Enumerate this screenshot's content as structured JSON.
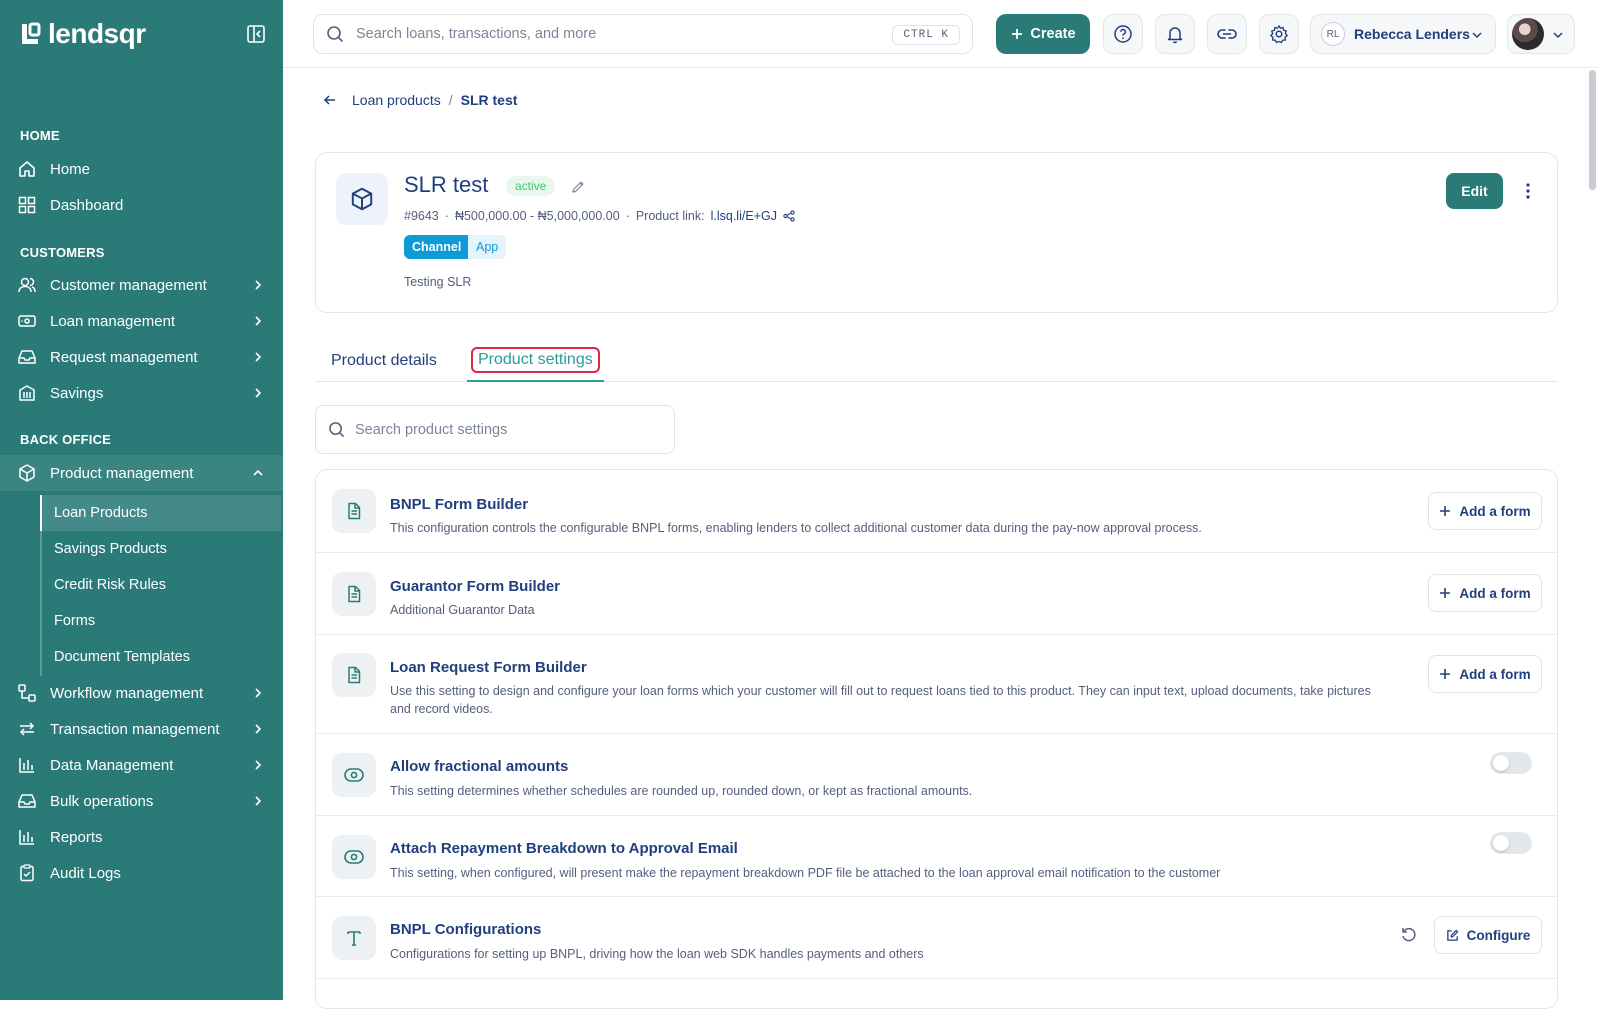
{
  "brand": {
    "name": "lendsqr"
  },
  "colors": {
    "sidebar": "#2a7a78",
    "primary": "#2a7a78",
    "accent_tab": "#2a9d98",
    "active_badge": "#39cd62",
    "channel_pill": "#0d9ad6",
    "highlight_outline": "#d9264a"
  },
  "sidebar": {
    "sections": [
      {
        "title": "HOME",
        "items": [
          {
            "label": "Home",
            "icon": "home-icon"
          },
          {
            "label": "Dashboard",
            "icon": "dashboard-icon"
          }
        ]
      },
      {
        "title": "CUSTOMERS",
        "items": [
          {
            "label": "Customer management",
            "icon": "users-icon"
          },
          {
            "label": "Loan management",
            "icon": "money-icon"
          },
          {
            "label": "Request management",
            "icon": "inbox-icon"
          },
          {
            "label": "Savings",
            "icon": "bank-icon"
          }
        ]
      },
      {
        "title": "BACK OFFICE",
        "items": [
          {
            "label": "Product management",
            "icon": "box-icon",
            "expanded": true,
            "children": [
              "Loan Products",
              "Savings Products",
              "Credit Risk Rules",
              "Forms",
              "Document Templates"
            ],
            "active_child": "Loan Products"
          },
          {
            "label": "Workflow management",
            "icon": "workflow-icon"
          },
          {
            "label": "Transaction management",
            "icon": "transfer-icon"
          },
          {
            "label": "Data Management",
            "icon": "bar-chart-icon"
          },
          {
            "label": "Bulk operations",
            "icon": "inbox-icon"
          },
          {
            "label": "Reports",
            "icon": "bar-chart-icon"
          },
          {
            "label": "Audit Logs",
            "icon": "clipboard-check-icon"
          }
        ]
      }
    ]
  },
  "topbar": {
    "search_placeholder": "Search loans, transactions, and more",
    "shortcut": "CTRL K",
    "create_label": "Create",
    "user_initials": "RL",
    "user_name": "Rebecca Lenders"
  },
  "breadcrumb": {
    "parent": "Loan products",
    "separator": "/",
    "current": "SLR test"
  },
  "product": {
    "name": "SLR test",
    "status": "active",
    "id": "#9643",
    "amount_range": "₦500,000.00 - ₦5,000,000.00",
    "link_label": "Product link:",
    "link": "l.lsq.li/E+GJ",
    "channel_label": "Channel",
    "channel_value": "App",
    "description": "Testing SLR",
    "edit_label": "Edit"
  },
  "tabs": [
    {
      "label": "Product details"
    },
    {
      "label": "Product settings",
      "active": true
    }
  ],
  "settings_search_placeholder": "Search product settings",
  "settings": [
    {
      "title": "BNPL Form Builder",
      "description": "This configuration controls the configurable BNPL forms, enabling lenders to collect additional customer data during the pay-now approval process.",
      "icon": "document-icon",
      "action": "Add a form"
    },
    {
      "title": "Guarantor Form Builder",
      "description": "Additional Guarantor Data",
      "icon": "document-icon",
      "action": "Add a form"
    },
    {
      "title": "Loan Request Form Builder",
      "description": "Use this setting to design and configure your loan forms which your customer will fill out to request loans tied to this product. They can input text, upload documents, take pictures and record videos.",
      "icon": "document-icon",
      "action": "Add a form"
    },
    {
      "title": "Allow fractional amounts",
      "description": "This setting determines whether schedules are rounded up, rounded down, or kept as fractional amounts.",
      "icon": "eye-icon",
      "toggle": false
    },
    {
      "title": "Attach Repayment Breakdown to Approval Email",
      "description": "This setting, when configured, will present make the repayment breakdown PDF file be attached to the loan approval email notification to the customer",
      "icon": "eye-icon",
      "toggle": false
    },
    {
      "title": "BNPL Configurations",
      "description": "Configurations for setting up BNPL, driving how the loan web SDK handles payments and others",
      "icon": "text-icon",
      "action": "Configure"
    }
  ]
}
